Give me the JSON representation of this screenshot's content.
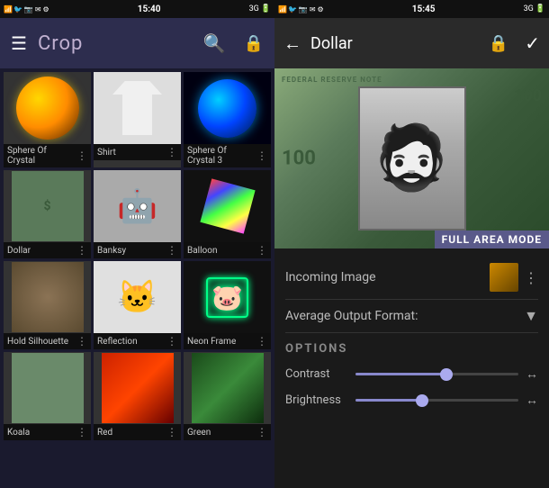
{
  "left": {
    "status": {
      "time": "15:40",
      "icons": "📶3G 🔋"
    },
    "header": {
      "title": "Crop",
      "hamburger": "☰",
      "search": "🔍",
      "lock": "🔒"
    },
    "grid_items": [
      {
        "label": "Sphere Of Crystal",
        "dots": "⋮",
        "type": "sphere"
      },
      {
        "label": "Shirt",
        "dots": "⋮",
        "type": "shirt"
      },
      {
        "label": "Sphere Of Crystal 3",
        "dots": "⋮",
        "type": "sphere3"
      },
      {
        "label": "Dollar",
        "dots": "⋮",
        "type": "dollar"
      },
      {
        "label": "Banksy",
        "dots": "⋮",
        "type": "banksy"
      },
      {
        "label": "Balloon",
        "dots": "⋮",
        "type": "balloon"
      },
      {
        "label": "Hold Silhouette",
        "dots": "⋮",
        "type": "hold"
      },
      {
        "label": "Reflection",
        "dots": "⋮",
        "type": "reflection"
      },
      {
        "label": "Neon Frame",
        "dots": "⋮",
        "type": "neon"
      },
      {
        "label": "Koala",
        "dots": "⋮",
        "type": "koala"
      },
      {
        "label": "Red",
        "dots": "⋮",
        "type": "red"
      },
      {
        "label": "Green",
        "dots": "⋮",
        "type": "green"
      }
    ]
  },
  "right": {
    "status": {
      "time": "15:45",
      "icons": "📶3G 🔋"
    },
    "header": {
      "title": "Dollar",
      "back": "←",
      "lock": "🔒",
      "check": "✓"
    },
    "full_area_label": "FULL AREA MODE",
    "incoming_label": "Incoming Image",
    "output_label": "Average Output Format:",
    "options_header": "OPTIONS",
    "contrast_label": "Contrast",
    "brightness_label": "Brightness",
    "contrast_value": 55,
    "brightness_value": 40,
    "arrows": "↔"
  }
}
